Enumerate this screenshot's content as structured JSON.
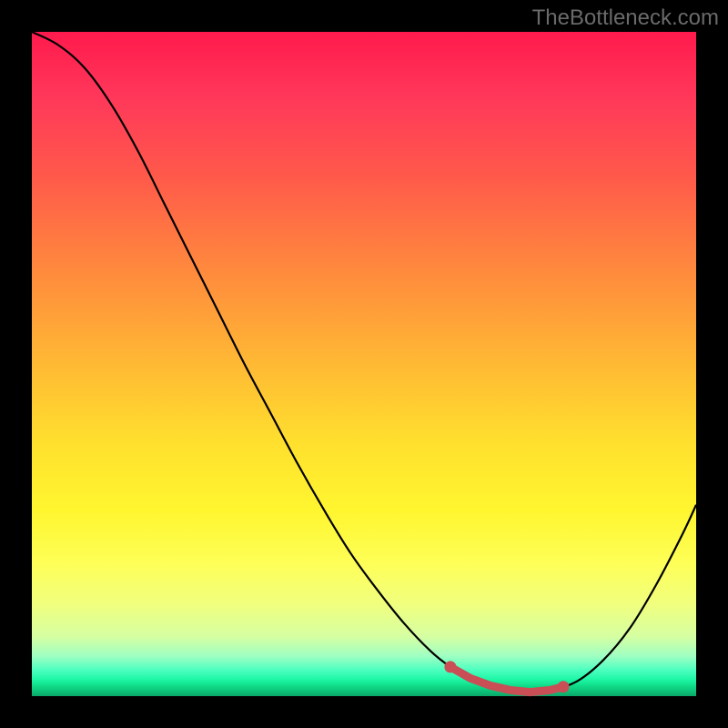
{
  "watermark": "TheBottleneck.com",
  "colors": {
    "frame": "#000000",
    "curve": "#000000",
    "marker_stroke": "#c94e55",
    "marker_fill_light": "#e2898f"
  },
  "chart_data": {
    "type": "line",
    "title": "",
    "xlabel": "",
    "ylabel": "",
    "xlim": [
      0,
      100
    ],
    "ylim": [
      0,
      100
    ],
    "x": [
      0,
      4,
      8,
      12,
      16,
      20,
      24,
      28,
      32,
      36,
      40,
      44,
      48,
      52,
      56,
      60,
      63,
      66,
      69,
      72,
      75,
      78,
      82,
      86,
      90,
      94,
      98,
      100
    ],
    "values": [
      100,
      98,
      94.5,
      89,
      82,
      74,
      66,
      58,
      50,
      42.5,
      35,
      28,
      21.5,
      16,
      11,
      6.8,
      4.4,
      2.7,
      1.6,
      0.9,
      0.6,
      0.9,
      2.2,
      5.4,
      10.2,
      16.8,
      24.5,
      28.8
    ],
    "markers": {
      "x": [
        63,
        66,
        69,
        72,
        75,
        78,
        80
      ],
      "y": [
        4.4,
        2.7,
        1.6,
        0.9,
        0.6,
        0.9,
        1.4
      ]
    }
  }
}
